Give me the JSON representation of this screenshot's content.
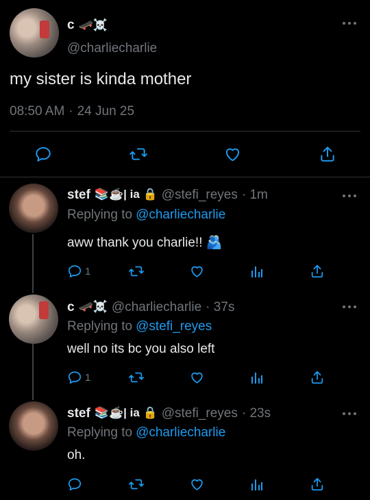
{
  "main_tweet": {
    "display_name": "c",
    "name_emojis": "🛹☠️",
    "handle": "@charliecharlie",
    "text": "my sister is kinda mother",
    "time": "08:50 AM",
    "separator": "·",
    "date": "24 Jun 25"
  },
  "replies": [
    {
      "display_name": "stef",
      "name_suffix": "📚☕️| ia 🔒",
      "handle": "@stefi_reyes",
      "age": "· 1m",
      "replying_prefix": "Replying to",
      "replying_to": "@charliecharlie",
      "text": "aww thank you charlie!! 🫂",
      "reply_count": "1"
    },
    {
      "display_name": "c",
      "name_suffix": "🛹☠️",
      "handle": "@charliecharlie",
      "age": "· 37s",
      "replying_prefix": "Replying to",
      "replying_to": "@stefi_reyes",
      "text": "well no its bc you also left",
      "reply_count": "1"
    },
    {
      "display_name": "stef",
      "name_suffix": "📚☕️| ia 🔒",
      "handle": "@stefi_reyes",
      "age": "· 23s",
      "replying_prefix": "Replying to",
      "replying_to": "@charliecharlie",
      "text": "oh.",
      "reply_count": ""
    }
  ],
  "icons": {
    "reply": "reply-icon",
    "retweet": "retweet-icon",
    "like": "heart-icon",
    "views": "views-icon",
    "share": "share-icon",
    "more": "more-icon"
  },
  "colors": {
    "background": "#000000",
    "text": "#e7e9ea",
    "secondary": "#71767b",
    "link": "#1d9bf0",
    "divider": "#2f3336"
  }
}
